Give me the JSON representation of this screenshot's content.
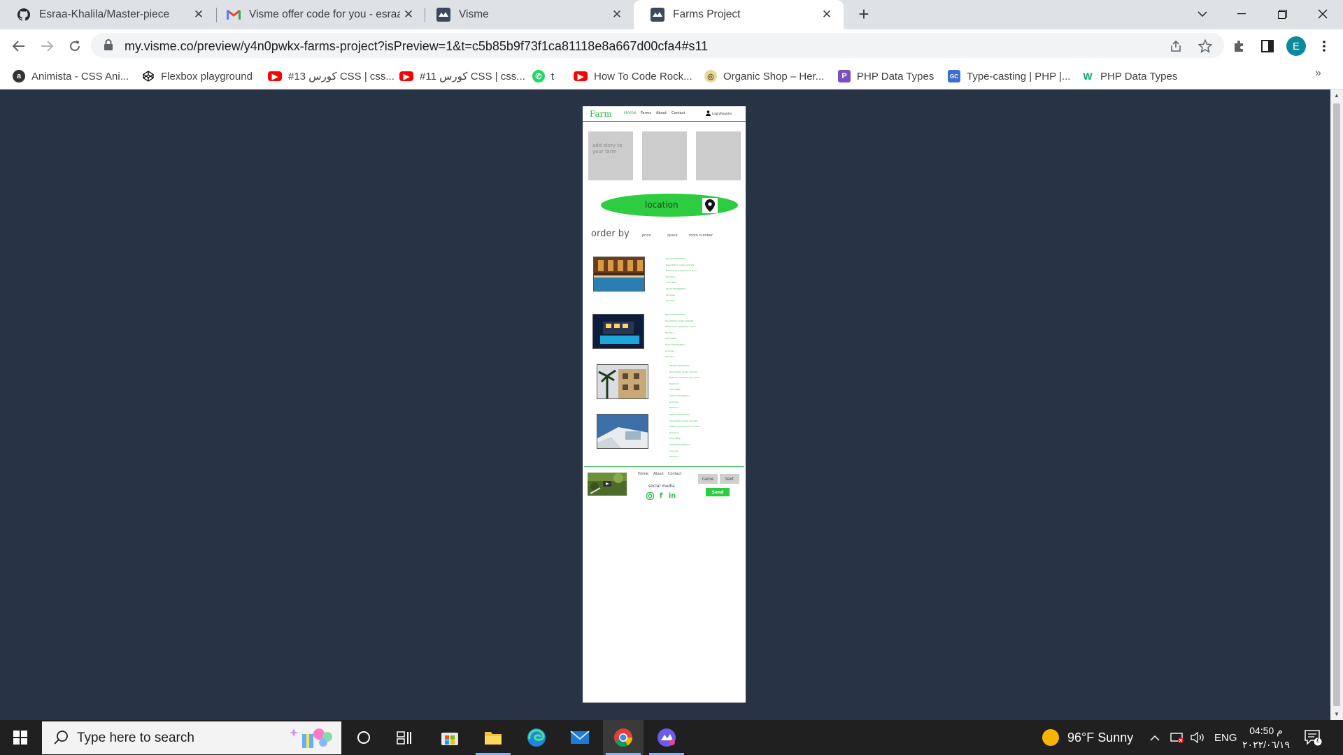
{
  "browser": {
    "tabs": [
      {
        "title": "Esraa-Khalila/Master-piece",
        "icon": "github-icon",
        "close": "✕"
      },
      {
        "title": "Visme offer code for you - esraa.k",
        "icon": "gmail-icon",
        "close": "✕"
      },
      {
        "title": "Visme",
        "icon": "visme-icon",
        "close": "✕"
      },
      {
        "title": "Farms Project",
        "icon": "visme-icon",
        "close": "✕",
        "active": true
      }
    ],
    "new_tab": "+",
    "url": "my.visme.co/preview/y4n0pwkx-farms-project?isPreview=1&t=c5b85b9f73f1ca81118e8a667d00cfa4#s11",
    "profile_initial": "E",
    "bookmarks": [
      {
        "label": "Animista - CSS Ani...",
        "icon": "animista-icon",
        "color": "#333333"
      },
      {
        "label": "Flexbox playground",
        "icon": "codepen-icon",
        "color": "#000000"
      },
      {
        "label": "#13 كورس CSS | css...",
        "icon": "youtube-icon",
        "color": "#ff0000"
      },
      {
        "label": "#11 كورس CSS | css...",
        "icon": "youtube-icon",
        "color": "#ff0000"
      },
      {
        "label": "t",
        "icon": "whatsapp-icon",
        "color": "#25d366"
      },
      {
        "label": "How To Code Rock...",
        "icon": "youtube-icon",
        "color": "#ff0000"
      },
      {
        "label": "Organic Shop – Her...",
        "icon": "organic-shop-icon",
        "color": "#c9b26b"
      },
      {
        "label": "PHP Data Types",
        "icon": "php-icon",
        "color": "#7a4fc4"
      },
      {
        "label": "Type-casting | PHP |...",
        "icon": "gc-icon",
        "color": "#3b6fd4"
      },
      {
        "label": "PHP Data Types",
        "icon": "w3schools-icon",
        "color": "#04aa6d"
      }
    ],
    "bookmarks_more": "»"
  },
  "mockup": {
    "logo": "Farm",
    "nav": [
      "Home",
      "Farms",
      "About",
      "Contact"
    ],
    "login": "Login/Register",
    "story_text": "add story to your farm",
    "location_label": "location",
    "order_by": "order by",
    "order_options": [
      "price",
      "space",
      "room number"
    ],
    "listing_lines": [
      "Name:TheVillaHero",
      "Description:ocean amenity",
      "Bathrooms 2 bedroom 1 pool",
      "Rooms:3",
      "Price:$85p",
      "Space:TheVillaHero",
      "pool:yes",
      "Rooms:3"
    ],
    "footer_links": [
      "Home",
      "About",
      "Contact"
    ],
    "social_label": "social media",
    "form": {
      "name": "name",
      "text": "text",
      "send": "Send"
    }
  },
  "taskbar": {
    "search_placeholder": "Type here to search",
    "weather": "96°F  Sunny",
    "language": "ENG",
    "time": "04:50 م",
    "date": "٢٠٢٢/٠٦/١٩",
    "notification_count": "٤"
  }
}
